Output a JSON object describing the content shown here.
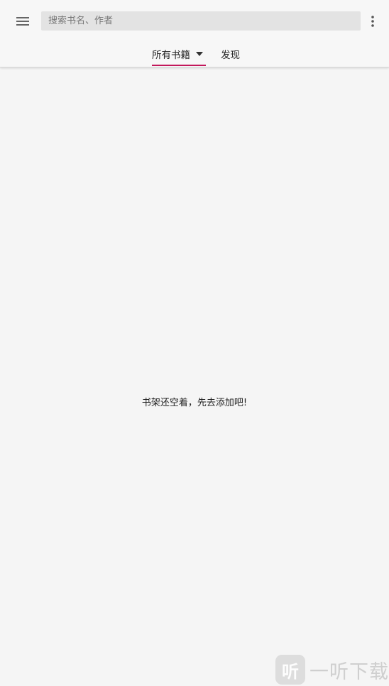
{
  "header": {
    "menu_icon": "hamburger-menu-icon",
    "search_placeholder": "搜索书名、作者",
    "more_icon": "more-vertical-icon"
  },
  "tabs": [
    {
      "label": "所有书籍",
      "selected": true,
      "has_dropdown": true
    },
    {
      "label": "发现",
      "selected": false
    }
  ],
  "colors": {
    "accent": "#c2185b",
    "background": "#f5f5f5"
  },
  "bookshelf": {
    "empty_message": "书架还空着，先去添加吧!"
  },
  "watermark": {
    "logo_char": "听",
    "text": "一听下载"
  }
}
